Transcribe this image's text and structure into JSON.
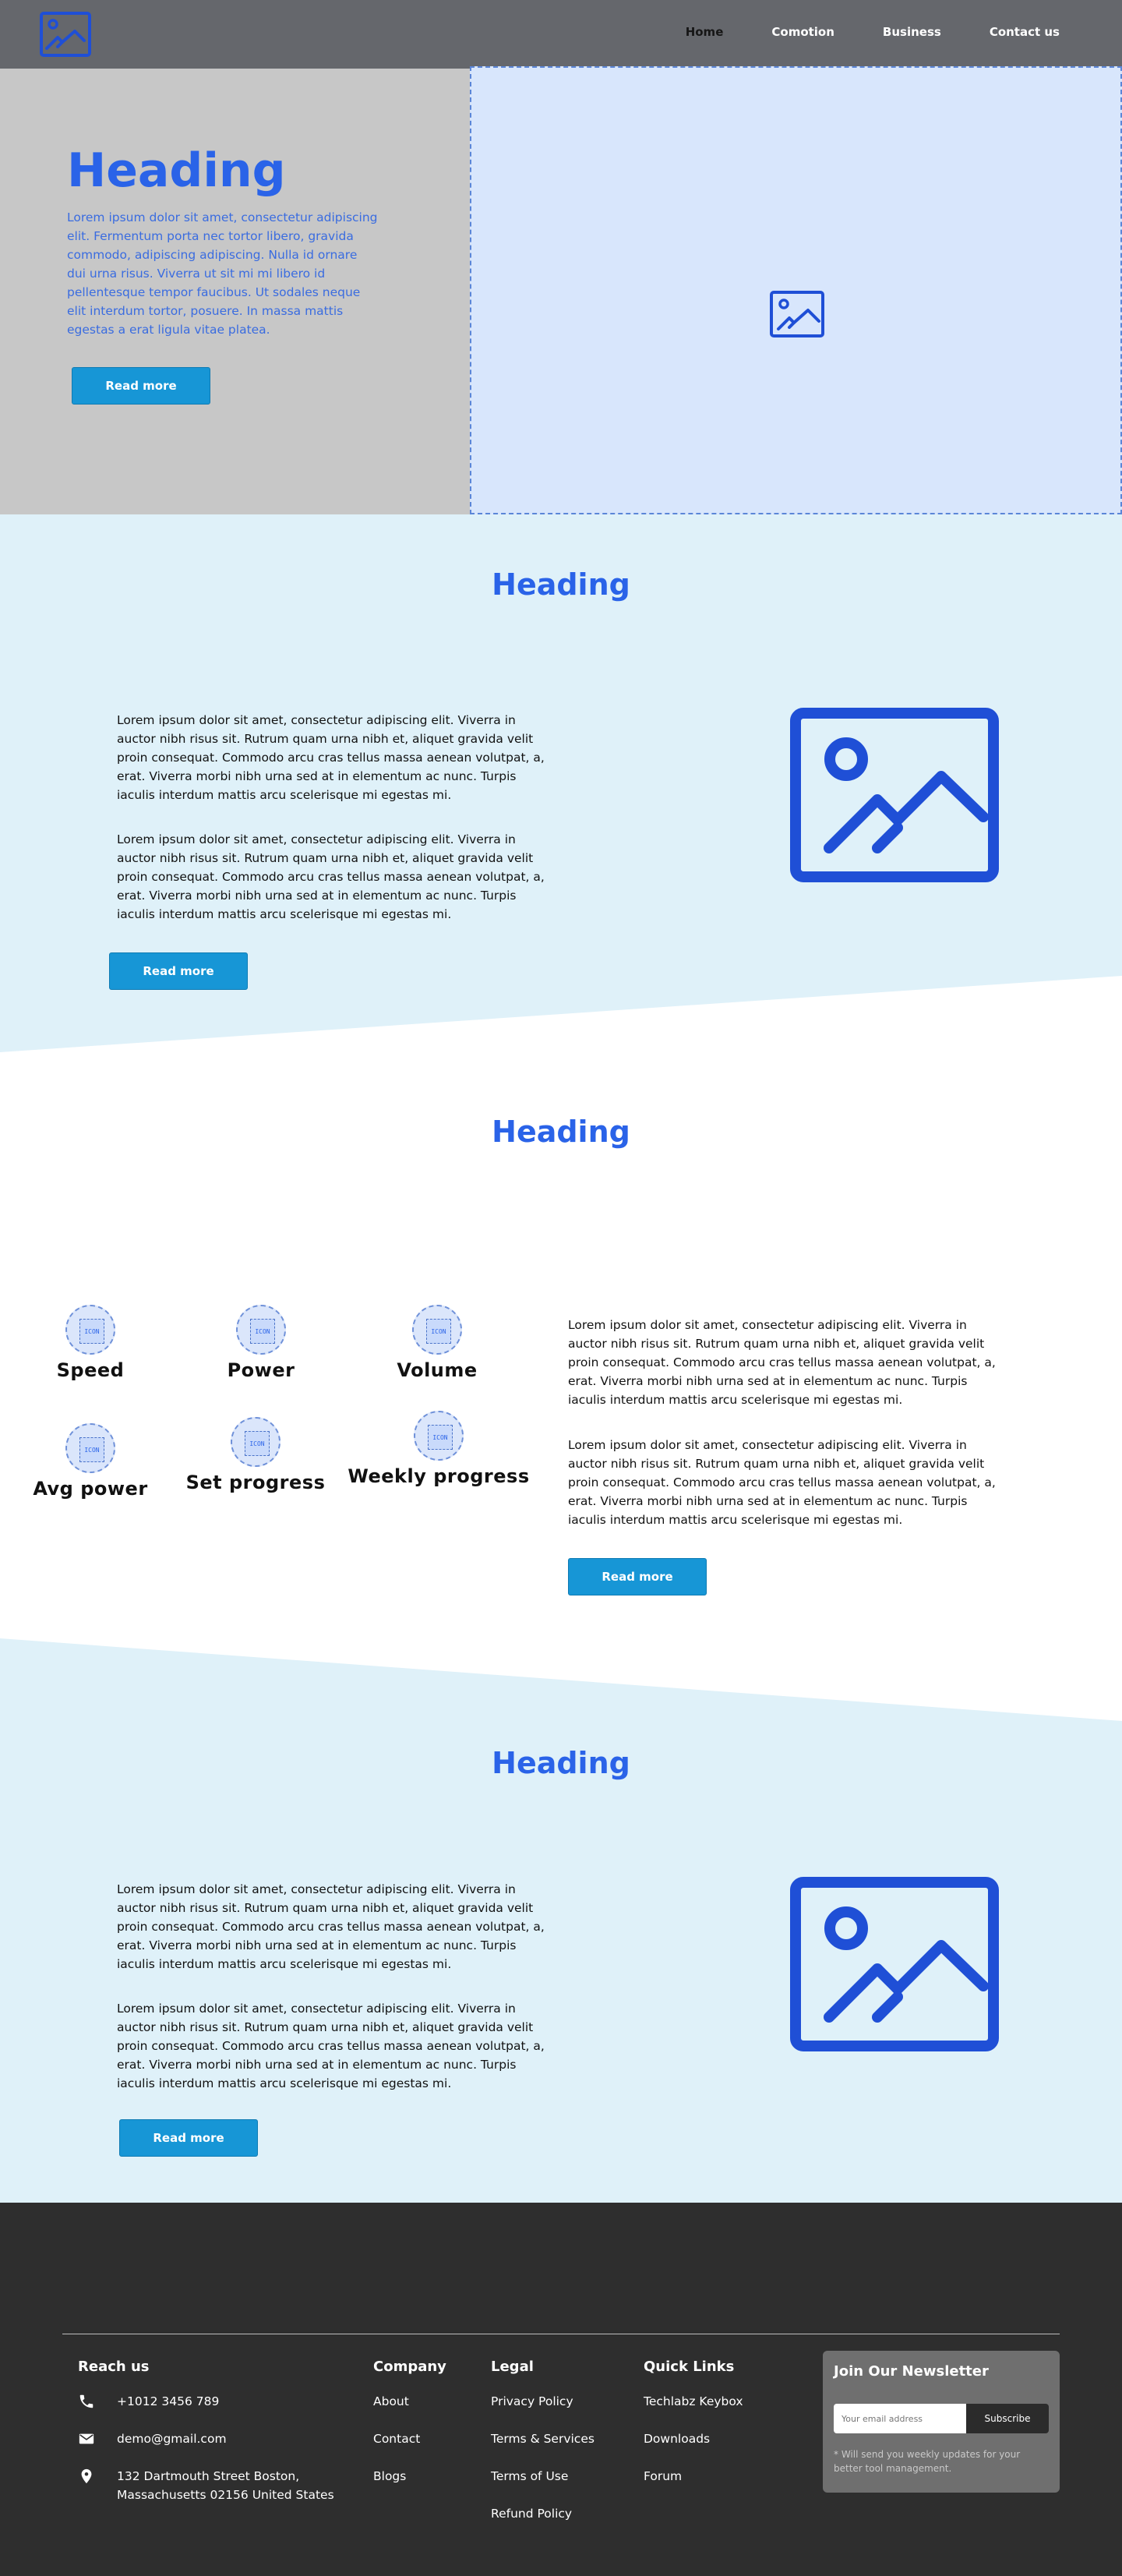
{
  "nav": {
    "items": [
      "Home",
      "Comotion",
      "Business",
      "Contact us"
    ]
  },
  "hero": {
    "heading": "Heading",
    "paragraph": "Lorem ipsum dolor sit amet, consectetur adipiscing elit. Fermentum porta nec tortor libero, gravida commodo, adipiscing adipiscing. Nulla id ornare dui urna risus. Viverra ut sit mi mi libero id pellentesque tempor faucibus. Ut sodales neque elit interdum tortor, posuere. In massa mattis egestas a erat ligula vitae platea.",
    "button": "Read more"
  },
  "section1": {
    "heading": "Heading",
    "paragraphs": [
      "Lorem ipsum dolor sit amet, consectetur adipiscing elit. Viverra in auctor nibh risus sit. Rutrum quam urna nibh et, aliquet gravida velit proin consequat. Commodo arcu cras tellus massa aenean volutpat, a, erat. Viverra morbi nibh urna sed at in elementum ac nunc. Turpis iaculis interdum mattis arcu scelerisque mi egestas mi.",
      "Lorem ipsum dolor sit amet, consectetur adipiscing elit. Viverra in auctor nibh risus sit. Rutrum quam urna nibh et, aliquet gravida velit proin consequat. Commodo arcu cras tellus massa aenean volutpat, a, erat. Viverra morbi nibh urna sed at in elementum ac nunc. Turpis iaculis interdum mattis arcu scelerisque mi egestas mi."
    ],
    "button": "Read more"
  },
  "section2": {
    "heading": "Heading",
    "features": [
      {
        "label": "Speed",
        "icon_text": "ICON"
      },
      {
        "label": "Power",
        "icon_text": "ICON"
      },
      {
        "label": "Volume",
        "icon_text": "ICON"
      },
      {
        "label": "Avg power",
        "icon_text": "ICON"
      },
      {
        "label": "Set progress",
        "icon_text": "ICON"
      },
      {
        "label": "Weekly progress",
        "icon_text": "ICON"
      }
    ],
    "paragraphs": [
      "Lorem ipsum dolor sit amet, consectetur adipiscing elit. Viverra in auctor nibh risus sit. Rutrum quam urna nibh et, aliquet gravida velit proin consequat. Commodo arcu cras tellus massa aenean volutpat, a, erat. Viverra morbi nibh urna sed at in elementum ac nunc. Turpis iaculis interdum mattis arcu scelerisque mi egestas mi.",
      "Lorem ipsum dolor sit amet, consectetur adipiscing elit. Viverra in auctor nibh risus sit. Rutrum quam urna nibh et, aliquet gravida velit proin consequat. Commodo arcu cras tellus massa aenean volutpat, a, erat. Viverra morbi nibh urna sed at in elementum ac nunc. Turpis iaculis interdum mattis arcu scelerisque mi egestas mi."
    ],
    "button": "Read more"
  },
  "section3": {
    "heading": "Heading",
    "paragraphs": [
      "Lorem ipsum dolor sit amet, consectetur adipiscing elit. Viverra in auctor nibh risus sit. Rutrum quam urna nibh et, aliquet gravida velit proin consequat. Commodo arcu cras tellus massa aenean volutpat, a, erat. Viverra morbi nibh urna sed at in elementum ac nunc. Turpis iaculis interdum mattis arcu scelerisque mi egestas mi.",
      "Lorem ipsum dolor sit amet, consectetur adipiscing elit. Viverra in auctor nibh risus sit. Rutrum quam urna nibh et, aliquet gravida velit proin consequat. Commodo arcu cras tellus massa aenean volutpat, a, erat. Viverra morbi nibh urna sed at in elementum ac nunc. Turpis iaculis interdum mattis arcu scelerisque mi egestas mi."
    ],
    "button": "Read more"
  },
  "footer": {
    "reach_us": {
      "title": "Reach us",
      "phone": "+1012 3456 789",
      "email": "demo@gmail.com",
      "address_line1": "132 Dartmouth Street Boston,",
      "address_line2": "Massachusetts 02156 United States"
    },
    "company": {
      "title": "Company",
      "links": [
        "About",
        "Contact",
        "Blogs"
      ]
    },
    "legal": {
      "title": "Legal",
      "links": [
        "Privacy Policy",
        "Terms & Services",
        "Terms of Use",
        "Refund Policy"
      ]
    },
    "quick_links": {
      "title": "Quick Links",
      "links": [
        "Techlabz Keybox",
        "Downloads",
        "Forum"
      ]
    },
    "newsletter": {
      "title": "Join Our Newsletter",
      "placeholder": "Your email address",
      "button": "Subscribe",
      "note": "* Will send you weekly updates for your better tool management."
    }
  },
  "colors": {
    "accent": "#2a63e8",
    "button": "#1796d6",
    "nav_bg": "#65676c",
    "hero_left_bg": "#c7c7c7",
    "hero_right_bg": "#d8e6fc",
    "band_bg": "#dff1f9",
    "footer_bg": "#2e2e2e"
  }
}
